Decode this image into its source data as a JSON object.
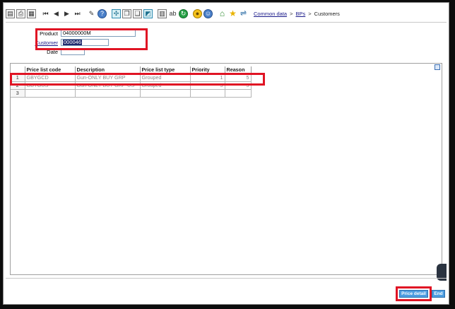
{
  "toolbar": {
    "icons": [
      "new-doc-icon",
      "print-icon",
      "print-preview-icon",
      "first-icon",
      "prev-icon",
      "next-icon",
      "last-icon",
      "link-icon",
      "help-icon",
      "grid-icon",
      "copy-icon",
      "paste-icon",
      "chart-icon",
      "columns-icon",
      "text-icon",
      "refresh-icon",
      "favorite-icon",
      "user-icon"
    ],
    "text_ab": "ab"
  },
  "breadcrumb": {
    "items": [
      "Common data",
      "BPs",
      "Customers"
    ],
    "separator": ">"
  },
  "form": {
    "product_label": "Product",
    "product_value": "04000000M",
    "customer_label": "Customer",
    "customer_value": "000046",
    "date_label": "Date",
    "date_value": ""
  },
  "grid": {
    "columns": [
      "Price list code",
      "Description",
      "Price list type",
      "Priority",
      "Reason"
    ],
    "rows": [
      {
        "num": "1",
        "code": "GBYGCD",
        "description": "Gun-ONLY BUY GRP",
        "type": "Grouped",
        "priority": "1",
        "reason": "5"
      },
      {
        "num": "2",
        "code": "GBYGUS",
        "description": "Gun-ONLY BUY GRP-US",
        "type": "Grouped",
        "priority": "5",
        "reason": "5"
      },
      {
        "num": "3",
        "code": "",
        "description": "",
        "type": "",
        "priority": "",
        "reason": ""
      }
    ]
  },
  "buttons": {
    "price_detail": "Price detail",
    "end": "End"
  },
  "colors": {
    "highlight": "#e01424",
    "button": "#4d9de0",
    "link": "#1a1a8a"
  }
}
